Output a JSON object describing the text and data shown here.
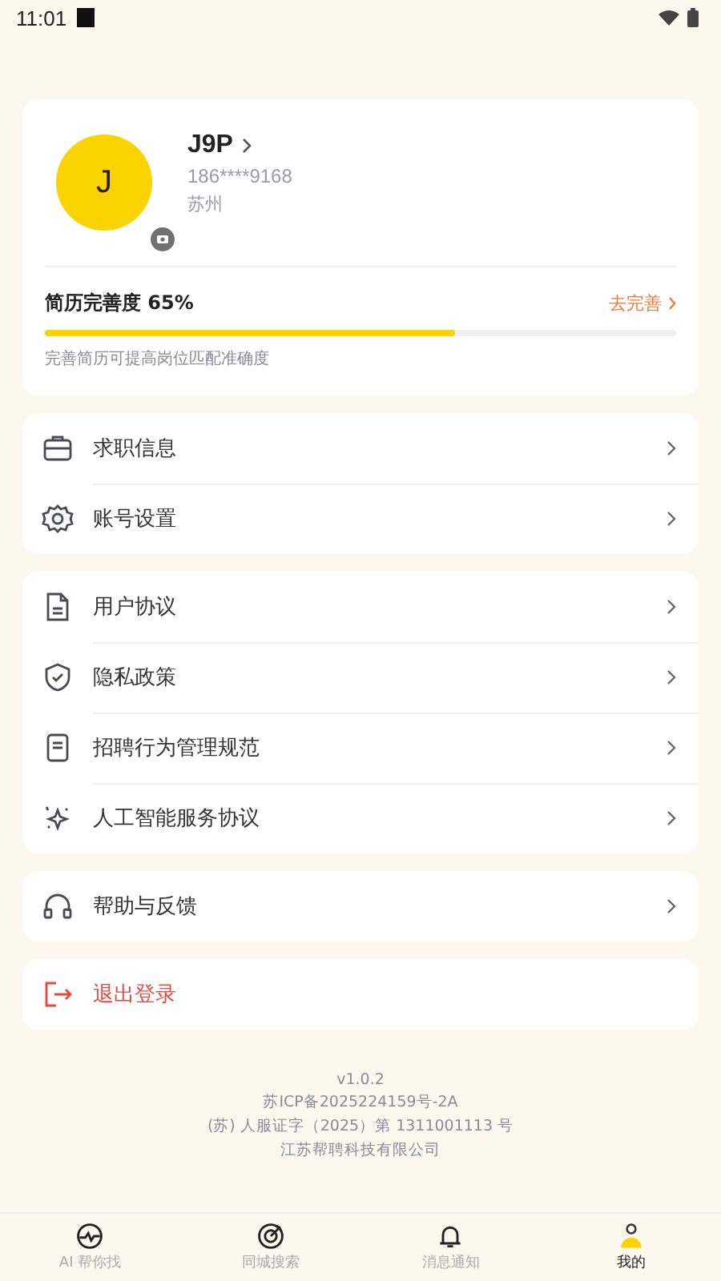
{
  "status_bar": {
    "time": "11:01"
  },
  "profile": {
    "avatar_letter": "J",
    "name": "J9P",
    "phone": "186****9168",
    "city": "苏州",
    "resume": {
      "label": "简历完善度 65%",
      "level": 0.65,
      "action": "去完善",
      "hint": "完善简历可提高岗位匹配准确度"
    }
  },
  "menu_groups": [
    {
      "items": [
        {
          "label": "求职信息",
          "kind": "normal"
        },
        {
          "label": "账号设置",
          "kind": "normal"
        }
      ]
    },
    {
      "items": [
        {
          "label": "用户协议",
          "kind": "normal"
        },
        {
          "label": "隐私政策",
          "kind": "normal"
        },
        {
          "label": "招聘行为管理规范",
          "kind": "normal"
        },
        {
          "label": "人工智能服务协议",
          "kind": "normal"
        }
      ]
    },
    {
      "items": [
        {
          "label": "帮助与反馈",
          "kind": "normal"
        }
      ]
    },
    {
      "items": [
        {
          "label": "退出登录",
          "kind": "danger"
        }
      ]
    }
  ],
  "footer": [
    "v1.0.2",
    "苏ICP备2025224159号-2A",
    "(苏) 人服证字（2025）第 1311001113 号",
    "江苏帮聘科技有限公司"
  ],
  "bottom_nav": [
    {
      "label": "AI 帮你找",
      "selected": false
    },
    {
      "label": "同城搜索",
      "selected": false
    },
    {
      "label": "消息通知",
      "selected": false
    },
    {
      "label": "我的",
      "selected": true
    }
  ]
}
